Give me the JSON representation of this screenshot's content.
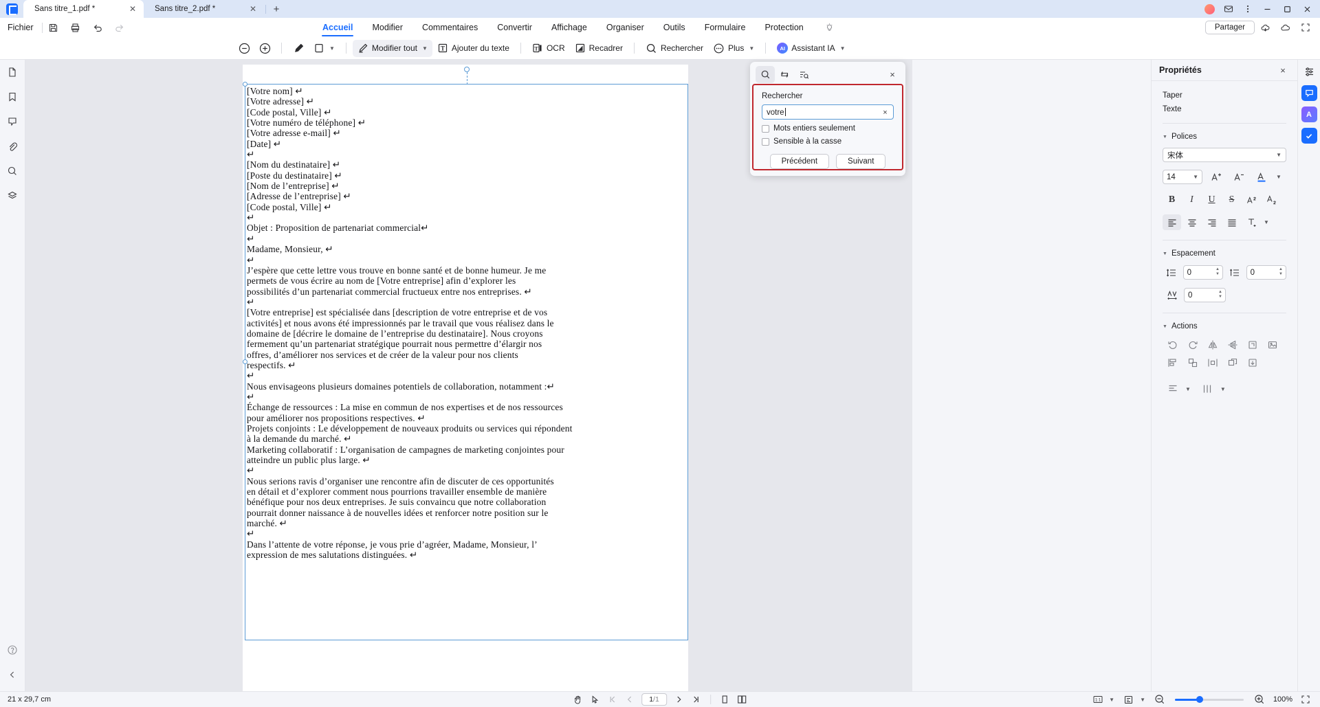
{
  "tabs": [
    {
      "label": "Sans titre_1.pdf *",
      "active": true
    },
    {
      "label": "Sans titre_2.pdf *",
      "active": false
    }
  ],
  "tabbar": {
    "new_tab": "+"
  },
  "menu": {
    "file_label": "Fichier",
    "save_icon": "save-icon",
    "print_icon": "print-icon",
    "undo_icon": "undo-icon",
    "redo_icon": "redo-icon"
  },
  "ribbon": {
    "tabs": [
      {
        "label": "Accueil",
        "active": true
      },
      {
        "label": "Modifier",
        "active": false
      },
      {
        "label": "Commentaires",
        "active": false
      },
      {
        "label": "Convertir",
        "active": false
      },
      {
        "label": "Affichage",
        "active": false
      },
      {
        "label": "Organiser",
        "active": false
      },
      {
        "label": "Outils",
        "active": false
      },
      {
        "label": "Formulaire",
        "active": false
      },
      {
        "label": "Protection",
        "active": false
      }
    ],
    "share_label": "Partager"
  },
  "toolbar": {
    "zoom_out": "zoom-out-icon",
    "zoom_in": "zoom-in-icon",
    "highlight": "highlighter-icon",
    "shape": "rectangle-icon",
    "edit_all_label": "Modifier tout",
    "add_text_label": "Ajouter du texte",
    "ocr_label": "OCR",
    "crop_label": "Recadrer",
    "search_label": "Rechercher",
    "more_label": "Plus",
    "ai_label": "Assistant IA",
    "ai_badge": "AI"
  },
  "left_sidebar": {
    "items": [
      {
        "icon": "page-thumbnail-icon"
      },
      {
        "icon": "bookmark-icon"
      },
      {
        "icon": "comment-icon"
      },
      {
        "icon": "attachment-icon"
      },
      {
        "icon": "search-icon"
      },
      {
        "icon": "layers-icon"
      }
    ],
    "help_icon": "help-icon",
    "collapse_icon": "chevron-left-icon"
  },
  "search_panel": {
    "tab_icons": [
      "search-icon",
      "replace-icon",
      "search-options-icon"
    ],
    "close": "×",
    "label": "Rechercher",
    "query": "votre",
    "clear": "×",
    "whole_words_label": "Mots entiers seulement",
    "whole_words_checked": false,
    "case_sensitive_label": "Sensible à la casse",
    "case_sensitive_checked": false,
    "previous_label": "Précédent",
    "next_label": "Suivant",
    "highlight_color": "#c0272d"
  },
  "properties": {
    "title": "Propriétés",
    "close": "×",
    "type_label": "Taper",
    "type_value": "Texte",
    "fonts_section": "Polices",
    "font_family": "宋体",
    "font_size": "14",
    "increase_font": "A⁺",
    "decrease_font": "A⁻",
    "font_color_icon": "font-color-icon",
    "bold": "B",
    "italic": "I",
    "underline": "U",
    "strikethrough": "S",
    "superscript": "superscript-icon",
    "subscript": "subscript-icon",
    "align_left": "align-left-icon",
    "align_center": "align-center-icon",
    "align_right": "align-right-icon",
    "align_justify": "align-justify-icon",
    "text_direction": "text-direction-icon",
    "spacing_section": "Espacement",
    "line_spacing_value": "0",
    "paragraph_spacing_value": "0",
    "char_spacing_value": "0",
    "actions_section": "Actions",
    "action_icons": [
      "rotate-left-icon",
      "rotate-right-icon",
      "flip-horizontal-icon",
      "flip-vertical-icon",
      "crop-icon",
      "replace-image-icon",
      "align-objects-icon",
      "group-icon",
      "distribute-icon",
      "arrange-icon",
      "extract-icon"
    ],
    "align_dropdown": "align-dropdown-icon",
    "distribute_dropdown": "distribute-dropdown-icon"
  },
  "right_rail": {
    "items": [
      {
        "icon": "properties-panel-icon"
      },
      {
        "icon": "chat-icon"
      },
      {
        "icon": "ai-tools-icon"
      },
      {
        "icon": "checkmark-icon"
      }
    ]
  },
  "status_bar": {
    "dimensions": "21 x 29,7 cm",
    "hand_tool": "hand-icon",
    "select_tool": "cursor-icon",
    "first_page": "first-page-icon",
    "prev_page": "prev-page-icon",
    "current_page": "1",
    "total_pages": "/1",
    "next_page": "next-page-icon",
    "last_page": "last-page-icon",
    "single_page_icon": "single-page-view-icon",
    "facing_page_icon": "facing-page-view-icon",
    "fit_ratio": "1:1",
    "page_layout_icon": "page-layout-icon",
    "zoom_out_icon": "zoom-out-icon",
    "zoom_level": "100%",
    "zoom_in_icon": "zoom-in-icon",
    "fullscreen_icon": "fullscreen-icon"
  },
  "document": {
    "text": "[Votre nom] ↵\n[Votre adresse] ↵\n[Code postal, Ville] ↵\n[Votre numéro de téléphone] ↵\n[Votre adresse e-mail] ↵\n[Date] ↵\n↵\n[Nom du destinataire] ↵\n[Poste du destinataire] ↵\n[Nom de l’entreprise] ↵\n[Adresse de l’entreprise] ↵\n[Code postal, Ville] ↵\n↵\nObjet : Proposition de partenariat commercial↵\n↵\nMadame, Monsieur, ↵\n↵\nJ’espère que cette lettre vous trouve en bonne santé et de bonne humeur. Je me\npermets de vous écrire au nom de [Votre entreprise] afin d’explorer les\npossibilités d’un partenariat commercial fructueux entre nos entreprises. ↵\n↵\n[Votre entreprise] est spécialisée dans [description de votre entreprise et de vos\nactivités] et nous avons été impressionnés par le travail que vous réalisez dans le\ndomaine de [décrire le domaine de l’entreprise du destinataire]. Nous croyons\nfermement qu’un partenariat stratégique pourrait nous permettre d’élargir nos\noffres, d’améliorer nos services et de créer de la valeur pour nos clients\nrespectifs. ↵\n↵\nNous envisageons plusieurs domaines potentiels de collaboration, notamment :↵\n↵\nÉchange de ressources : La mise en commun de nos expertises et de nos ressources\npour améliorer nos propositions respectives. ↵\nProjets conjoints : Le développement de nouveaux produits ou services qui répondent\nà la demande du marché. ↵\nMarketing collaboratif : L’organisation de campagnes de marketing conjointes pour\natteindre un public plus large. ↵\n↵\nNous serions ravis d’organiser une rencontre afin de discuter de ces opportunités\nen détail et d’explorer comment nous pourrions travailler ensemble de manière\nbénéfique pour nos deux entreprises. Je suis convaincu que notre collaboration\npourrait donner naissance à de nouvelles idées et renforcer notre position sur le\nmarché. ↵\n↵\nDans l’attente de votre réponse, je vous prie d’agréer, Madame, Monsieur, l’\nexpression de mes salutations distinguées. ↵"
  }
}
